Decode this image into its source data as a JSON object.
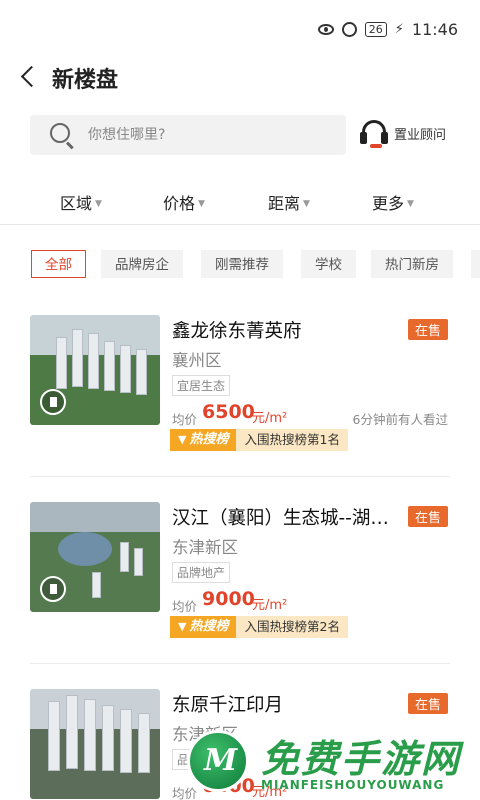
{
  "status_bar": {
    "battery": "26",
    "time": "11:46"
  },
  "nav": {
    "title": "新楼盘"
  },
  "search": {
    "placeholder": "你想住哪里?",
    "advisor_label": "置业顾问"
  },
  "filters": [
    {
      "label": "区域"
    },
    {
      "label": "价格"
    },
    {
      "label": "距离"
    },
    {
      "label": "更多"
    }
  ],
  "tags": [
    {
      "label": "全部",
      "active": true
    },
    {
      "label": "品牌房企",
      "active": false
    },
    {
      "label": "刚需推荐",
      "active": false
    },
    {
      "label": "学校",
      "active": false
    },
    {
      "label": "热门新房",
      "active": false
    }
  ],
  "listings": [
    {
      "name": "鑫龙徐东菁英府",
      "status": "在售",
      "district": "襄州区",
      "feature": "宜居生态",
      "price_label": "均价",
      "price": "6500",
      "unit": "元/m²",
      "viewers": "6分钟前有人看过",
      "rank_hot": "热搜榜",
      "rank_text": "入围热搜榜第1名"
    },
    {
      "name": "汉江（襄阳）生态城--湖…",
      "status": "在售",
      "district": "东津新区",
      "feature": "品牌地产",
      "price_label": "均价",
      "price": "9000",
      "unit": "元/m²",
      "viewers": "",
      "rank_hot": "热搜榜",
      "rank_text": "入围热搜榜第2名"
    },
    {
      "name": "东原千江印月",
      "status": "在售",
      "district": "东津新区",
      "feature": "品",
      "price_label": "均价",
      "price": "6400",
      "unit": "元/m²",
      "viewers": ""
    }
  ],
  "watermark": {
    "title": "免费手游网",
    "subtitle": "MIANFEISHOUYOUWANG"
  },
  "colors": {
    "accent": "#e0452b",
    "status_badge": "#e8692c",
    "hot_badge": "#f5a623",
    "watermark": "#2a9d4a"
  }
}
